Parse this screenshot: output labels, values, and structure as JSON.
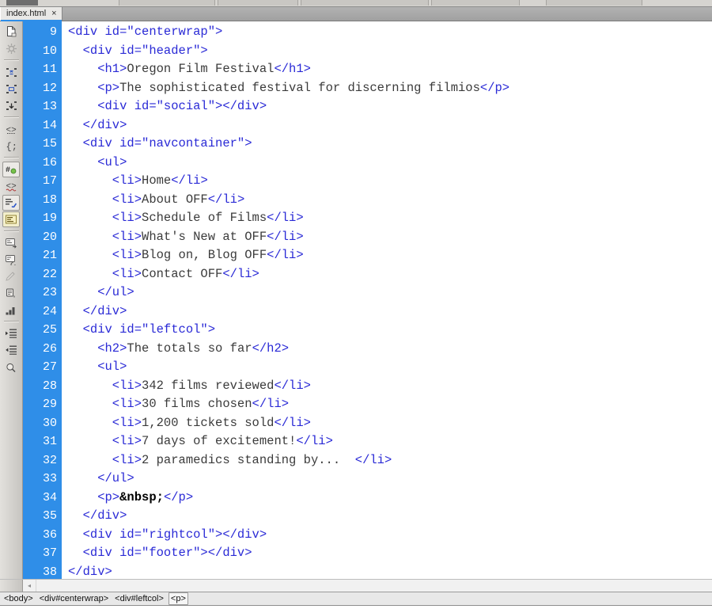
{
  "window": {
    "tab": {
      "label": "index.html",
      "close_glyph": "×"
    }
  },
  "coding_toolbar": {
    "name": "Coding toolbar",
    "buttons": [
      {
        "name": "open-documents-icon",
        "state": "normal"
      },
      {
        "name": "collapse-full-tag-icon",
        "state": "disabled"
      },
      {
        "name": "collapse-outside-selection-icon",
        "state": "normal"
      },
      {
        "name": "expand-all-icon",
        "state": "normal"
      },
      {
        "name": "select-parent-tag-icon",
        "state": "normal"
      },
      {
        "name": "balance-braces-icon",
        "state": "normal"
      },
      {
        "name": "line-numbers-icon",
        "state": "normal"
      },
      {
        "name": "highlight-invalid-code-icon",
        "state": "framed"
      },
      {
        "name": "syntax-error-alerts-icon",
        "state": "normal"
      },
      {
        "name": "apply-comment-icon",
        "state": "framed"
      },
      {
        "name": "remove-comment-icon",
        "state": "framed-gold"
      },
      {
        "name": "wrap-tag-icon",
        "state": "normal"
      },
      {
        "name": "recent-snippets-icon",
        "state": "normal"
      },
      {
        "name": "move-css-rules-icon",
        "state": "disabled"
      },
      {
        "name": "indent-code-icon",
        "state": "normal"
      },
      {
        "name": "outdent-code-icon",
        "state": "normal"
      },
      {
        "name": "format-source-code-icon",
        "state": "normal"
      },
      {
        "name": "show-code-navigator-icon",
        "state": "normal"
      }
    ]
  },
  "editor": {
    "first_line_number": 9,
    "lines": [
      {
        "n": 9,
        "tokens": [
          {
            "t": "tag",
            "v": "<div id=\"centerwrap\">"
          }
        ]
      },
      {
        "n": 10,
        "tokens": [
          {
            "t": "tag",
            "v": "  <div id=\"header\">"
          }
        ]
      },
      {
        "n": 11,
        "tokens": [
          {
            "t": "tag",
            "v": "    <h1>"
          },
          {
            "t": "txt",
            "v": "Oregon Film Festival"
          },
          {
            "t": "tag",
            "v": "</h1>"
          }
        ]
      },
      {
        "n": 12,
        "tokens": [
          {
            "t": "tag",
            "v": "    <p>"
          },
          {
            "t": "txt",
            "v": "The sophisticated festival for discerning filmios"
          },
          {
            "t": "tag",
            "v": "</p>"
          }
        ]
      },
      {
        "n": 13,
        "tokens": [
          {
            "t": "tag",
            "v": "    <div id=\"social\"></div>"
          }
        ]
      },
      {
        "n": 14,
        "tokens": [
          {
            "t": "tag",
            "v": "  </div>"
          }
        ]
      },
      {
        "n": 15,
        "tokens": [
          {
            "t": "tag",
            "v": "  <div id=\"navcontainer\">"
          }
        ]
      },
      {
        "n": 16,
        "tokens": [
          {
            "t": "tag",
            "v": "    <ul>"
          }
        ]
      },
      {
        "n": 17,
        "tokens": [
          {
            "t": "tag",
            "v": "      <li>"
          },
          {
            "t": "txt",
            "v": "Home"
          },
          {
            "t": "tag",
            "v": "</li>"
          }
        ]
      },
      {
        "n": 18,
        "tokens": [
          {
            "t": "tag",
            "v": "      <li>"
          },
          {
            "t": "txt",
            "v": "About OFF"
          },
          {
            "t": "tag",
            "v": "</li>"
          }
        ]
      },
      {
        "n": 19,
        "tokens": [
          {
            "t": "tag",
            "v": "      <li>"
          },
          {
            "t": "txt",
            "v": "Schedule of Films"
          },
          {
            "t": "tag",
            "v": "</li>"
          }
        ]
      },
      {
        "n": 20,
        "tokens": [
          {
            "t": "tag",
            "v": "      <li>"
          },
          {
            "t": "txt",
            "v": "What's New at OFF"
          },
          {
            "t": "tag",
            "v": "</li>"
          }
        ]
      },
      {
        "n": 21,
        "tokens": [
          {
            "t": "tag",
            "v": "      <li>"
          },
          {
            "t": "txt",
            "v": "Blog on, Blog OFF"
          },
          {
            "t": "tag",
            "v": "</li>"
          }
        ]
      },
      {
        "n": 22,
        "tokens": [
          {
            "t": "tag",
            "v": "      <li>"
          },
          {
            "t": "txt",
            "v": "Contact OFF"
          },
          {
            "t": "tag",
            "v": "</li>"
          }
        ]
      },
      {
        "n": 23,
        "tokens": [
          {
            "t": "tag",
            "v": "    </ul>"
          }
        ]
      },
      {
        "n": 24,
        "tokens": [
          {
            "t": "tag",
            "v": "  </div>"
          }
        ]
      },
      {
        "n": 25,
        "tokens": [
          {
            "t": "tag",
            "v": "  <div id=\"leftcol\">"
          }
        ]
      },
      {
        "n": 26,
        "tokens": [
          {
            "t": "tag",
            "v": "    <h2>"
          },
          {
            "t": "txt",
            "v": "The totals so far"
          },
          {
            "t": "tag",
            "v": "</h2>"
          }
        ]
      },
      {
        "n": 27,
        "tokens": [
          {
            "t": "tag",
            "v": "    <ul>"
          }
        ]
      },
      {
        "n": 28,
        "tokens": [
          {
            "t": "tag",
            "v": "      <li>"
          },
          {
            "t": "txt",
            "v": "342 films reviewed"
          },
          {
            "t": "tag",
            "v": "</li>"
          }
        ]
      },
      {
        "n": 29,
        "tokens": [
          {
            "t": "tag",
            "v": "      <li>"
          },
          {
            "t": "txt",
            "v": "30 films chosen"
          },
          {
            "t": "tag",
            "v": "</li>"
          }
        ]
      },
      {
        "n": 30,
        "tokens": [
          {
            "t": "tag",
            "v": "      <li>"
          },
          {
            "t": "txt",
            "v": "1,200 tickets sold"
          },
          {
            "t": "tag",
            "v": "</li>"
          }
        ]
      },
      {
        "n": 31,
        "tokens": [
          {
            "t": "tag",
            "v": "      <li>"
          },
          {
            "t": "txt",
            "v": "7 days of excitement!"
          },
          {
            "t": "tag",
            "v": "</li>"
          }
        ]
      },
      {
        "n": 32,
        "tokens": [
          {
            "t": "tag",
            "v": "      <li>"
          },
          {
            "t": "txt",
            "v": "2 paramedics standing by...  "
          },
          {
            "t": "tag",
            "v": "</li>"
          }
        ]
      },
      {
        "n": 33,
        "tokens": [
          {
            "t": "tag",
            "v": "    </ul>"
          }
        ]
      },
      {
        "n": 34,
        "tokens": [
          {
            "t": "tag",
            "v": "    <p>"
          },
          {
            "t": "ent",
            "v": "&nbsp;"
          },
          {
            "t": "tag",
            "v": "</p>"
          }
        ]
      },
      {
        "n": 35,
        "tokens": [
          {
            "t": "tag",
            "v": "  </div>"
          }
        ]
      },
      {
        "n": 36,
        "tokens": [
          {
            "t": "tag",
            "v": "  <div id=\"rightcol\"></div>"
          }
        ]
      },
      {
        "n": 37,
        "tokens": [
          {
            "t": "tag",
            "v": "  <div id=\"footer\"></div>"
          }
        ]
      },
      {
        "n": 38,
        "tokens": [
          {
            "t": "tag",
            "v": "</div>"
          }
        ]
      }
    ],
    "colors": {
      "gutter_bg": "#2f8ee8",
      "gutter_fg": "#ffffff",
      "tag": "#2a2ad6",
      "text": "#3b3b3b",
      "entity": "#000000",
      "background": "#ffffff"
    }
  },
  "scrollbar": {
    "left_arrow_glyph": "◂"
  },
  "tag_selector": {
    "items": [
      {
        "label": "<body>",
        "selected": false
      },
      {
        "label": "<div#centerwrap>",
        "selected": false
      },
      {
        "label": "<div#leftcol>",
        "selected": false
      },
      {
        "label": "<p>",
        "selected": true
      }
    ]
  }
}
